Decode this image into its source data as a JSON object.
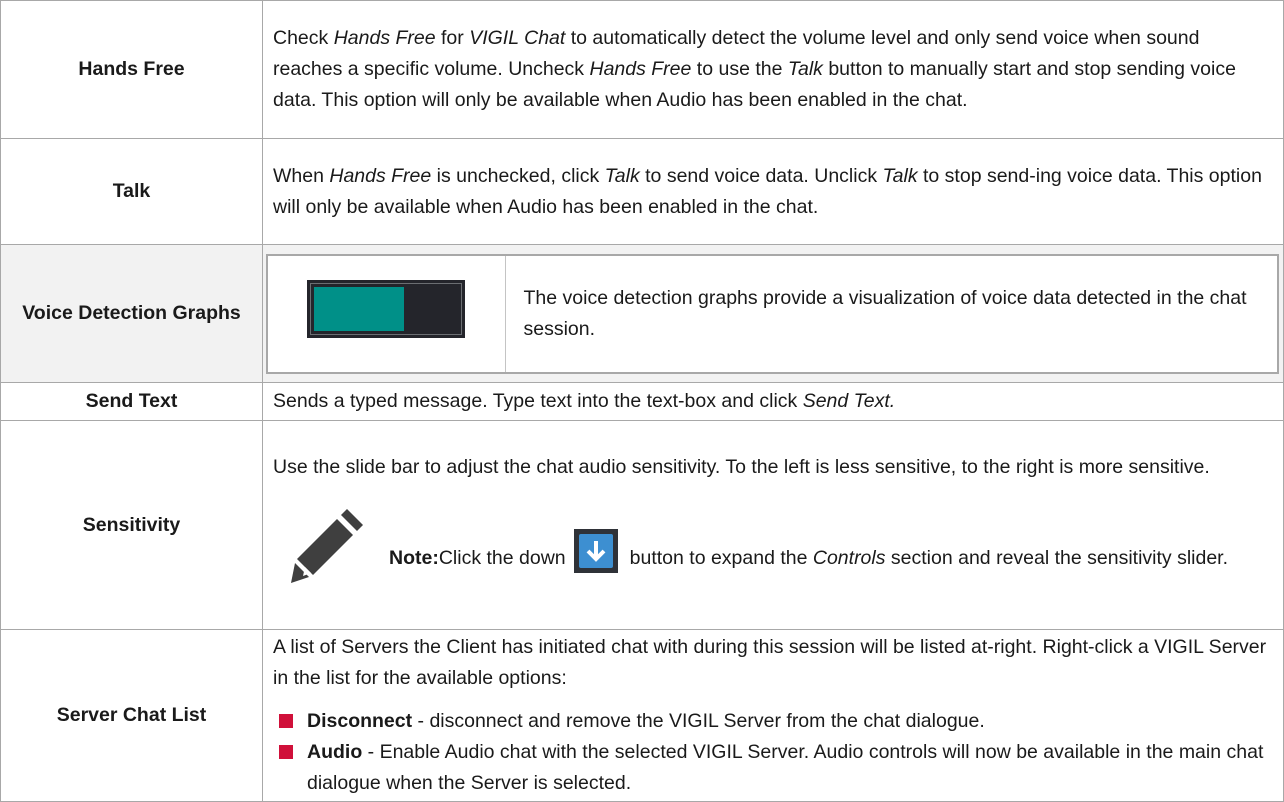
{
  "colors": {
    "bullet": "#d0103a",
    "graph_fill": "#009088",
    "graph_bg": "#24252b",
    "button_blue": "#3d8fd1"
  },
  "rows": {
    "hands_free": {
      "label": "Hands Free",
      "t1": "Check ",
      "t2": "Hands Free",
      "t3": " for ",
      "t4": "VIGIL Chat",
      "t5": " to automatically detect the volume level and only send voice when sound reaches a specific volume. Uncheck ",
      "t6": "Hands Free",
      "t7": " to use the ",
      "t8": "Talk",
      "t9": " button to manually start and stop sending voice data. This option will only be available when Audio has been enabled in the chat."
    },
    "talk": {
      "label": "Talk",
      "t1": "When ",
      "t2": "Hands Free",
      "t3": " is unchecked, click ",
      "t4": "Talk",
      "t5": " to send voice data. Unclick ",
      "t6": "Talk",
      "t7": " to stop send-ing voice data. This option will only be available when Audio has been enabled in the chat."
    },
    "voice_graphs": {
      "label": "Voice Detection Graphs",
      "description": "The voice detection graphs provide a visualization of voice data detected in the chat session.",
      "graph_level": 0.62,
      "graph_icon": "voice-level-graph-icon"
    },
    "send_text": {
      "label": "Send Text",
      "t1": "Sends a typed message. Type text into the text-box and click ",
      "t2": "Send Text."
    },
    "sensitivity": {
      "label": "Sensitivity",
      "description": "Use the slide bar to adjust the chat audio sensitivity. To the left is less sensitive, to the right is more sensitive.",
      "note_label": "Note:",
      "note_t1": "Click the down",
      "note_t2": "button to expand the ",
      "note_t3": "Controls",
      "note_t4": " section and reveal the sensitivity slider.",
      "note_icon": "pencil-icon",
      "button_icon": "down-arrow-icon"
    },
    "server_chat_list": {
      "label": "Server Chat List",
      "intro": "A list of Servers the Client has initiated chat with during this session will be listed at-right. Right-click a VIGIL Server in the list for the available options:",
      "items": [
        {
          "term": "Disconnect",
          "text": " - disconnect and remove the VIGIL Server from the chat dialogue."
        },
        {
          "term": "Audio",
          "text": " - Enable Audio chat with the selected VIGIL Server. Audio controls will now be available in the main chat dialogue when the Server is selected."
        }
      ]
    }
  }
}
